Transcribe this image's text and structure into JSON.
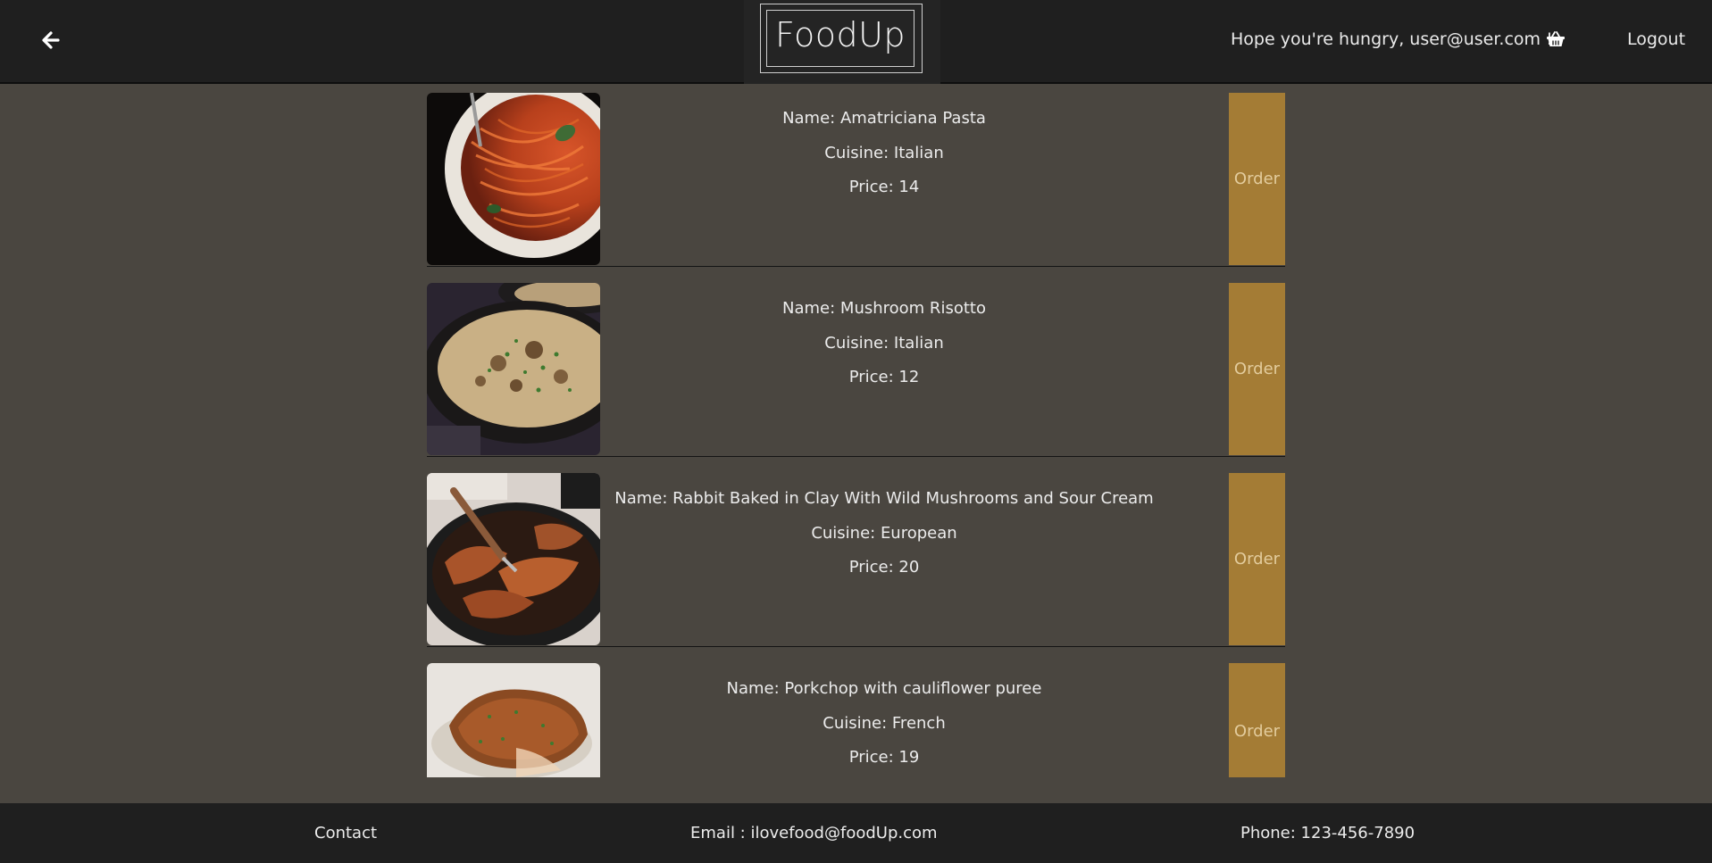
{
  "header": {
    "logo_text": "FoodUp",
    "greeting": "Hope you're hungry, user@user.com !",
    "logout_label": "Logout"
  },
  "dishes": [
    {
      "name": "Name: Amatriciana Pasta",
      "cuisine": "Cuisine: Italian",
      "price": "Price: 14",
      "order_label": "Order"
    },
    {
      "name": "Name: Mushroom Risotto",
      "cuisine": "Cuisine: Italian",
      "price": "Price: 12",
      "order_label": "Order"
    },
    {
      "name": "Name: Rabbit Baked in Clay With Wild Mushrooms and Sour Cream",
      "cuisine": "Cuisine: European",
      "price": "Price: 20",
      "order_label": "Order"
    },
    {
      "name": "Name: Porkchop with cauliflower puree",
      "cuisine": "Cuisine: French",
      "price": "Price: 19",
      "order_label": "Order"
    }
  ],
  "footer": {
    "contact": "Contact",
    "email": "Email : ilovefood@foodUp.com",
    "phone": "Phone: 123-456-7890"
  },
  "colors": {
    "header_bg": "#1f1f1f",
    "page_bg": "#4a4640",
    "order_button": "#a47c35"
  },
  "icons": [
    "arrow-left-icon",
    "shopping-basket-icon"
  ]
}
